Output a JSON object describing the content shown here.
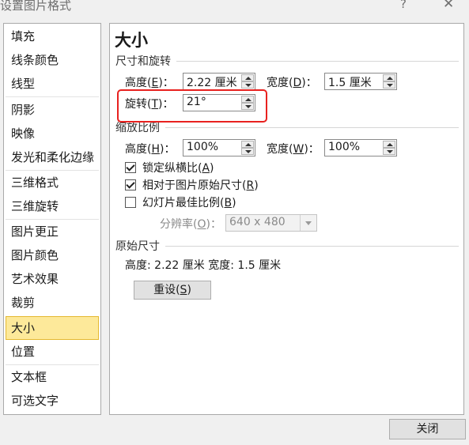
{
  "window": {
    "title": "设置图片格式",
    "help_label": "?",
    "close_label": "✕"
  },
  "sidebar": {
    "items": [
      {
        "label": "填充"
      },
      {
        "label": "线条颜色"
      },
      {
        "label": "线型"
      },
      {
        "label": "阴影"
      },
      {
        "label": "映像"
      },
      {
        "label": "发光和柔化边缘"
      },
      {
        "label": "三维格式"
      },
      {
        "label": "三维旋转"
      },
      {
        "label": "图片更正"
      },
      {
        "label": "图片颜色"
      },
      {
        "label": "艺术效果"
      },
      {
        "label": "裁剪"
      },
      {
        "label": "大小"
      },
      {
        "label": "位置"
      },
      {
        "label": "文本框"
      },
      {
        "label": "可选文字"
      }
    ],
    "selected": "大小"
  },
  "main": {
    "heading": "大小",
    "size_rotate": {
      "section_label": "尺寸和旋转",
      "height_label": "高度(",
      "height_key": "E",
      "height_value": "2.22 厘米",
      "width_label": "宽度(",
      "width_key": "D",
      "width_value": "1.5 厘米",
      "rotation_label": "旋转(",
      "rotation_key": "T",
      "rotation_value": "21°",
      "label_suffix": ")："
    },
    "scale": {
      "section_label": "缩放比例",
      "height_label": "高度(",
      "height_key": "H",
      "height_value": "100%",
      "width_label": "宽度(",
      "width_key": "W",
      "width_value": "100%",
      "label_suffix": ")：",
      "lock_ratio_label": "锁定纵横比(",
      "lock_ratio_key": "A",
      "lock_ratio_checked": true,
      "relative_label": "相对于图片原始尺寸(",
      "relative_key": "R",
      "relative_checked": true,
      "slideshow_label": "幻灯片最佳比例(",
      "slideshow_key": "B",
      "slideshow_checked": false,
      "close_paren": ")",
      "resolution_label": "分辨率(",
      "resolution_key": "O",
      "resolution_suffix": ")：",
      "resolution_value": "640 x 480"
    },
    "original": {
      "section_label": "原始尺寸",
      "text": "高度:  2.22 厘米   宽度:  1.5 厘米",
      "reset_label": "重设(",
      "reset_key": "S",
      "reset_suffix": ")"
    }
  },
  "footer": {
    "close_label": "关闭"
  },
  "colors": {
    "highlight": "#e8211f",
    "selected_bg": "#fde99a",
    "selected_border": "#e5b930"
  }
}
